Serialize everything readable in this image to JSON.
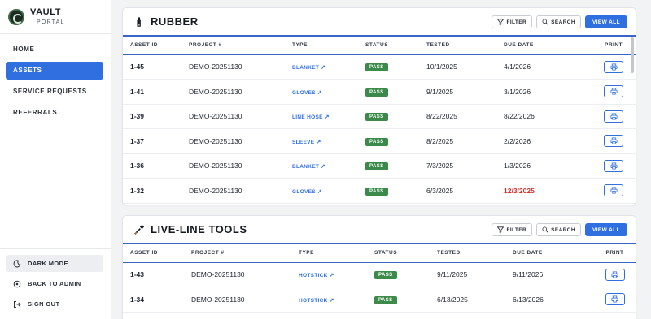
{
  "brand": {
    "title": "VAULT",
    "subtitle": "PORTAL"
  },
  "nav": [
    {
      "label": "HOME",
      "active": false
    },
    {
      "label": "ASSETS",
      "active": true
    },
    {
      "label": "SERVICE REQUESTS",
      "active": false
    },
    {
      "label": "REFERRALS",
      "active": false
    }
  ],
  "bottom_nav": {
    "dark_mode": "DARK MODE",
    "back_to_admin": "BACK TO ADMIN",
    "sign_out": "SIGN OUT"
  },
  "actions": {
    "filter": "FILTER",
    "search": "SEARCH",
    "view_all": "VIEW ALL"
  },
  "columns": {
    "asset_id": "ASSET ID",
    "project": "PROJECT #",
    "type": "TYPE",
    "status": "STATUS",
    "tested": "TESTED",
    "due_date": "DUE DATE",
    "print": "PRINT"
  },
  "sections": [
    {
      "title": "RUBBER",
      "icon": "glove-icon",
      "rows": [
        {
          "asset_id": "1-45",
          "project": "DEMO-20251130",
          "type": "BLANKET",
          "status": "PASS",
          "tested": "10/1/2025",
          "due": "4/1/2026",
          "overdue": false
        },
        {
          "asset_id": "1-41",
          "project": "DEMO-20251130",
          "type": "GLOVES",
          "status": "PASS",
          "tested": "9/1/2025",
          "due": "3/1/2026",
          "overdue": false
        },
        {
          "asset_id": "1-39",
          "project": "DEMO-20251130",
          "type": "LINE HOSE",
          "status": "PASS",
          "tested": "8/22/2025",
          "due": "8/22/2026",
          "overdue": false
        },
        {
          "asset_id": "1-37",
          "project": "DEMO-20251130",
          "type": "SLEEVE",
          "status": "PASS",
          "tested": "8/2/2025",
          "due": "2/2/2026",
          "overdue": false
        },
        {
          "asset_id": "1-36",
          "project": "DEMO-20251130",
          "type": "BLANKET",
          "status": "PASS",
          "tested": "7/3/2025",
          "due": "1/3/2026",
          "overdue": false
        },
        {
          "asset_id": "1-32",
          "project": "DEMO-20251130",
          "type": "GLOVES",
          "status": "PASS",
          "tested": "6/3/2025",
          "due": "12/3/2025",
          "overdue": true
        }
      ]
    },
    {
      "title": "LIVE-LINE TOOLS",
      "icon": "tool-icon",
      "rows": [
        {
          "asset_id": "1-43",
          "project": "DEMO-20251130",
          "type": "HOTSTICK",
          "status": "PASS",
          "tested": "9/11/2025",
          "due": "9/11/2026",
          "overdue": false
        },
        {
          "asset_id": "1-34",
          "project": "DEMO-20251130",
          "type": "HOTSTICK",
          "status": "PASS",
          "tested": "6/13/2025",
          "due": "6/13/2026",
          "overdue": false
        }
      ]
    }
  ],
  "colors": {
    "accent": "#2f6fe0",
    "pass": "#3b8a4a",
    "overdue": "#d0312d"
  }
}
